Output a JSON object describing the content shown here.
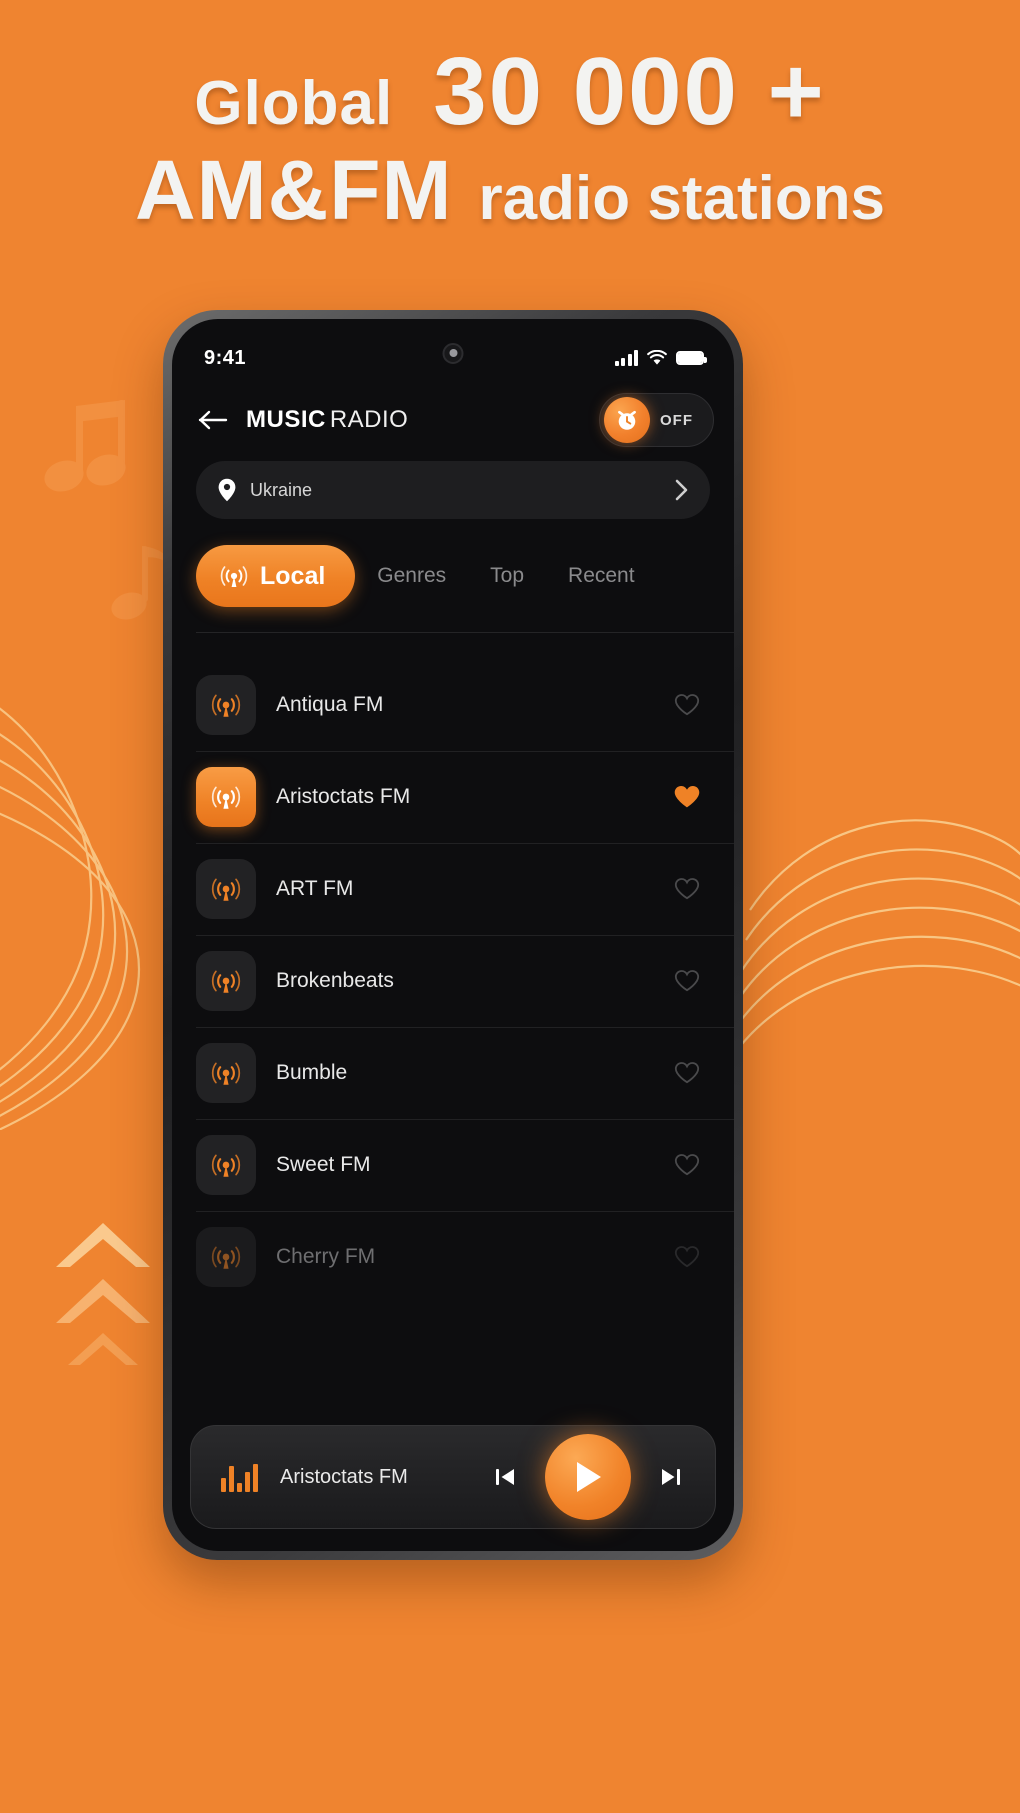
{
  "theme": {
    "background": "#ef8430",
    "accent": "#ef8226",
    "screen_bg": "#0d0d0f"
  },
  "headline": {
    "line1_word1": "Global",
    "line1_word2": "30 000 +",
    "line2_word1": "AM&FM",
    "line2_word2": "radio stations"
  },
  "status_bar": {
    "time": "9:41",
    "signal_icon": "signal-bars-icon",
    "wifi_icon": "wifi-icon",
    "battery_icon": "battery-icon"
  },
  "header": {
    "back_icon": "back-arrow-icon",
    "title_strong": "MUSIC",
    "title_light": "RADIO",
    "timer": {
      "icon": "alarm-clock-icon",
      "state_label": "OFF"
    }
  },
  "location": {
    "pin_icon": "location-pin-icon",
    "value": "Ukraine",
    "chevron_icon": "chevron-right-icon"
  },
  "tabs": [
    {
      "label": "Local",
      "active": true,
      "icon": "broadcast-icon"
    },
    {
      "label": "Genres",
      "active": false
    },
    {
      "label": "Top",
      "active": false
    },
    {
      "label": "Recent",
      "active": false
    }
  ],
  "stations": [
    {
      "name": "Antiqua FM",
      "playing": false,
      "favorite": false,
      "faded": false
    },
    {
      "name": "Aristoctats FM",
      "playing": true,
      "favorite": true,
      "faded": false
    },
    {
      "name": "ART FM",
      "playing": false,
      "favorite": false,
      "faded": false
    },
    {
      "name": "Brokenbeats",
      "playing": false,
      "favorite": false,
      "faded": false
    },
    {
      "name": "Bumble",
      "playing": false,
      "favorite": false,
      "faded": false
    },
    {
      "name": "Sweet FM",
      "playing": false,
      "favorite": false,
      "faded": false
    },
    {
      "name": "Cherry FM",
      "playing": false,
      "favorite": false,
      "faded": true
    }
  ],
  "player": {
    "equalizer_icon": "equalizer-icon",
    "now_playing": "Aristoctats FM",
    "previous_icon": "skip-previous-icon",
    "play_icon": "play-icon",
    "next_icon": "skip-next-icon"
  }
}
